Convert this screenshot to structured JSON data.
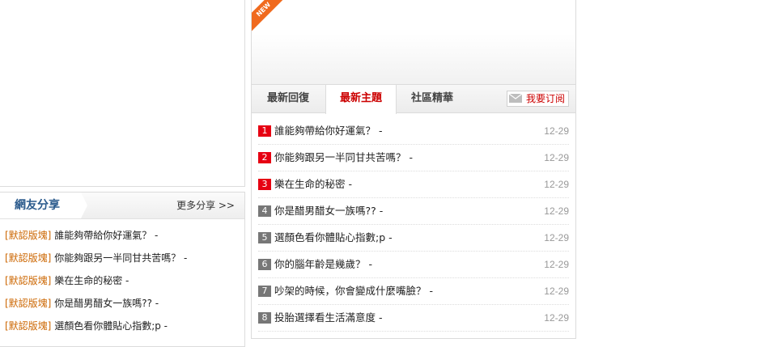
{
  "share": {
    "title": "網友分享",
    "more": "更多分享 >>",
    "items": [
      {
        "tag": "[默認版塊]",
        "text": "誰能夠帶給你好運氣？ -"
      },
      {
        "tag": "[默認版塊]",
        "text": "你能夠跟另一半同甘共苦嗎？ -"
      },
      {
        "tag": "[默認版塊]",
        "text": "樂在生命的秘密 -"
      },
      {
        "tag": "[默認版塊]",
        "text": "你是醋男醋女一族嗎?? -"
      },
      {
        "tag": "[默認版塊]",
        "text": "選顏色看你體貼心指數;p -"
      }
    ]
  },
  "banner": {
    "badge": "NEW"
  },
  "tabs": {
    "items": [
      "最新回復",
      "最新主題",
      "社區精華"
    ],
    "active": "最新主題",
    "subscribe": "我要订阅"
  },
  "topics": [
    {
      "rank": "1",
      "hot": true,
      "title": "誰能夠帶給你好運氣？ -",
      "date": "12-29"
    },
    {
      "rank": "2",
      "hot": true,
      "title": "你能夠跟另一半同甘共苦嗎？ -",
      "date": "12-29"
    },
    {
      "rank": "3",
      "hot": true,
      "title": "樂在生命的秘密 -",
      "date": "12-29"
    },
    {
      "rank": "4",
      "hot": false,
      "title": "你是醋男醋女一族嗎?? -",
      "date": "12-29"
    },
    {
      "rank": "5",
      "hot": false,
      "title": "選顏色看你體貼心指數;p -",
      "date": "12-29"
    },
    {
      "rank": "6",
      "hot": false,
      "title": "你的腦年齡是幾歲？ -",
      "date": "12-29"
    },
    {
      "rank": "7",
      "hot": false,
      "title": "吵架的時候，你會變成什麼嘴臉？ -",
      "date": "12-29"
    },
    {
      "rank": "8",
      "hot": false,
      "title": "投胎選擇看生活滿意度 -",
      "date": "12-29"
    }
  ],
  "colors": {
    "accent": "#cc0000",
    "hot_rank": "#e60012",
    "normal_rank": "#777777",
    "tag": "#cc6600"
  }
}
